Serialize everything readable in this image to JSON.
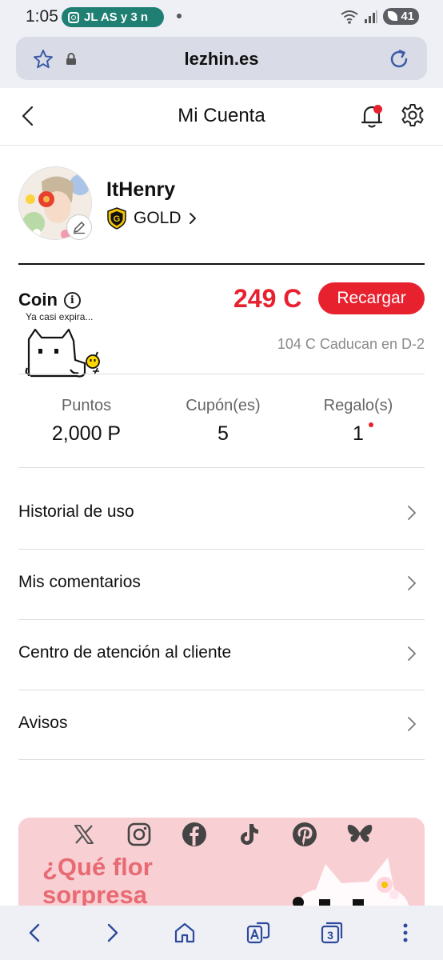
{
  "status_bar": {
    "time": "1:05",
    "notification_text": "JL AS y 3 n",
    "battery": "41"
  },
  "browser": {
    "url": "lezhin.es",
    "tabs_count": "3"
  },
  "header": {
    "title": "Mi Cuenta"
  },
  "profile": {
    "username": "ItHenry",
    "tier_badge": "G",
    "tier": "GOLD"
  },
  "coin": {
    "label": "Coin",
    "info_glyph": "i",
    "balance": "249 C",
    "recharge_label": "Recargar",
    "expiring_tag": "Ya casi expira...",
    "expiry_note": "104 C Caducan en D-2"
  },
  "stats": [
    {
      "label": "Puntos",
      "value": "2,000 P"
    },
    {
      "label": "Cupón(es)",
      "value": "5"
    },
    {
      "label": "Regalo(s)",
      "value": "1"
    }
  ],
  "menu": [
    {
      "label": "Historial de uso"
    },
    {
      "label": "Mis comentarios"
    },
    {
      "label": "Centro de atención al cliente"
    },
    {
      "label": "Avisos"
    }
  ],
  "banner": {
    "title_line1": "¿Qué flor",
    "title_line2": "sorpresa",
    "social_icons": [
      "x-icon",
      "instagram-icon",
      "facebook-icon",
      "tiktok-icon",
      "pinterest-icon",
      "bluesky-icon"
    ]
  },
  "colors": {
    "accent": "#e8212f",
    "gold": "#f5c400",
    "banner_bg": "#f8cfd3",
    "banner_text": "#e86a73",
    "browser_chrome": "#eef0f6",
    "nav_icon": "#2d4a9c"
  }
}
